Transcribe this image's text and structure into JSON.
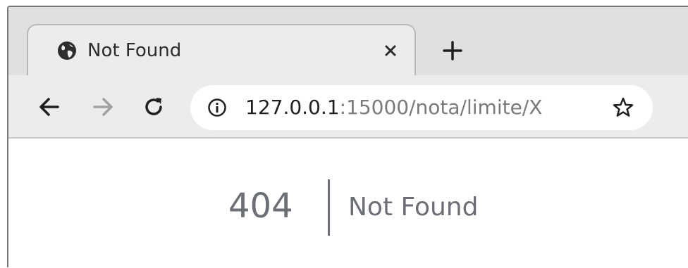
{
  "tab": {
    "title": "Not Found",
    "favicon": "globe-icon",
    "close_icon": "close-icon"
  },
  "newtab": {
    "icon": "plus-icon"
  },
  "toolbar": {
    "back_icon": "arrow-left-icon",
    "forward_icon": "arrow-right-icon",
    "forward_enabled": false,
    "reload_icon": "reload-icon",
    "bookmark_icon": "star-icon"
  },
  "omnibox": {
    "security_icon": "info-icon",
    "url_host": "127.0.0.1",
    "url_rest": ":15000/nota/limite/X"
  },
  "page": {
    "code": "404",
    "message": "Not Found"
  },
  "colors": {
    "tabstrip_bg": "#e0e0e0",
    "active_tab_bg": "#ececec",
    "error_text": "#6b6f75"
  }
}
